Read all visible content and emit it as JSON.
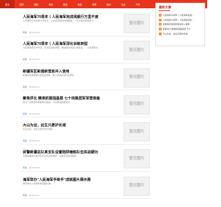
{
  "nav": {
    "items": [
      {
        "label": "首页",
        "active": true
      },
      {
        "label": "国内",
        "active": false
      },
      {
        "label": "国际",
        "active": false
      },
      {
        "label": "军事",
        "active": false
      },
      {
        "label": "财经",
        "active": false
      },
      {
        "label": "科技",
        "active": false
      },
      {
        "label": "体育",
        "active": false
      },
      {
        "label": "娱乐",
        "active": false
      },
      {
        "label": "社会",
        "active": false
      },
      {
        "label": "汽车",
        "active": false
      }
    ]
  },
  "articles": [
    {
      "title": "人民海军70周年丨人民海军完成阅舰行万里不疲",
      "summary": "人民海军今年迎来70岁生日。从白手起家到向海图强，一代代官兵接续奋斗……",
      "tag": "军迷",
      "date": "2019-04-23",
      "thumb_text": "暂无图片"
    },
    {
      "title": "人民海军70周年丨人民海军深化训练转型",
      "summary": "人民海军成立70年来，深化实战化训练，推进新型作战力量建设……人民海军以……",
      "tag": "军迷",
      "date": "2019-04-22",
      "thumb_text": "暂无图片"
    },
    {
      "title": "新疆军区新建新营房并入使用",
      "summary": "新疆军区某部官兵告别旧营房，搬入新建的现代化营区……",
      "tag": "军迷",
      "date": "2019-04-21",
      "thumb_text": "暂无图片"
    },
    {
      "title": "聚焦评比 精准抓建强基层 七十四集团军军营装备",
      "summary": "第七十四集团军聚焦练兵备战，扎实推进基层建设……",
      "tag": "军迷",
      "date": "2019-04-20",
      "thumb_text": "暂无图片"
    },
    {
      "title": "大山为证，此生只愿护长城",
      "summary": "大山为证：此生只愿守护长城的……",
      "tag": "军迷",
      "date": "2019-04-19",
      "thumb_text": "暂无图片"
    },
    {
      "title": "武警新疆总队某支队设置陷阱锤炼队伍实战硬功",
      "summary": "武警新疆总队某支队针对实战化要求，设置复杂情况陷阱……",
      "tag": "军迷",
      "date": "2019-04-18",
      "thumb_text": "暂无图片"
    },
    {
      "title": "海军举办\"人民海军手牵手\"成就图片展示展",
      "summary": "海军举办人民海军成就图片展……",
      "tag": "军迷",
      "date": "2019-04-17",
      "thumb_text": "暂无图片"
    }
  ],
  "sidebar": {
    "title": "最新文章",
    "items": [
      {
        "num": "1",
        "text": "人民海军70周年丨人民海军完成…"
      },
      {
        "num": "2",
        "text": "人民海军70周年丨人民海军深化…"
      },
      {
        "num": "3",
        "text": "新疆军区新建新营房并入使用"
      },
      {
        "num": "4",
        "text": "聚焦评比 精准抓建强基层 七十…"
      },
      {
        "num": "5",
        "text": "大山为证，此生只愿护长城"
      }
    ]
  },
  "colors": {
    "nav_bg": "#e8341c",
    "nav_active": "#c42411",
    "accent": "#c0392b",
    "badge": "#f08c3a"
  }
}
